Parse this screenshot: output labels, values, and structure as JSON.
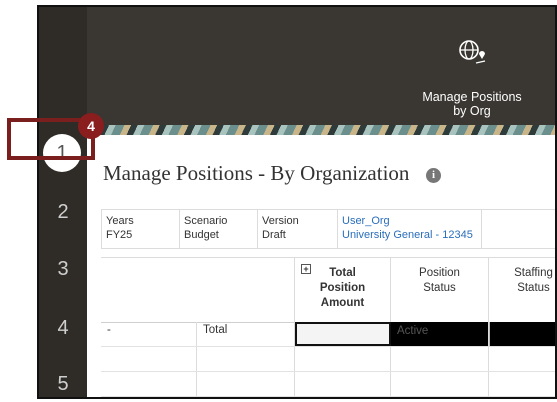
{
  "rail": {
    "items": [
      "1",
      "2",
      "3",
      "4",
      "5"
    ],
    "active_index": 0
  },
  "header": {
    "nav_tile": {
      "icon": "globe-location-icon",
      "line1": "Manage Positions",
      "line2": "by Org"
    }
  },
  "page": {
    "title": "Manage Positions - By Organization",
    "info_glyph": "i"
  },
  "pov": {
    "years": {
      "label": "Years",
      "value": "FY25"
    },
    "scenario": {
      "label": "Scenario",
      "value": "Budget"
    },
    "version": {
      "label": "Version",
      "value": "Draft"
    },
    "org": {
      "label": "User_Org",
      "value": "University General - 12345"
    }
  },
  "grid": {
    "expand_glyph": "+",
    "columns": [
      "Total Position Amount",
      "Position Status",
      "Staffing Status"
    ],
    "col1_line1": "Total",
    "col1_line2": "Position",
    "col1_line3": "Amount",
    "col2_line1": "Position",
    "col2_line2": "Status",
    "col3_line1": "Staffing",
    "col3_line2": "Status",
    "row1": {
      "dash": "-",
      "label": "Total",
      "position_status": "Active"
    }
  },
  "callout": {
    "badge": "4"
  },
  "colors": {
    "rail_bg": "#2f2b27",
    "header_bg": "#3a3632",
    "link": "#2a6ebb",
    "callout": "#8a1d1d"
  }
}
